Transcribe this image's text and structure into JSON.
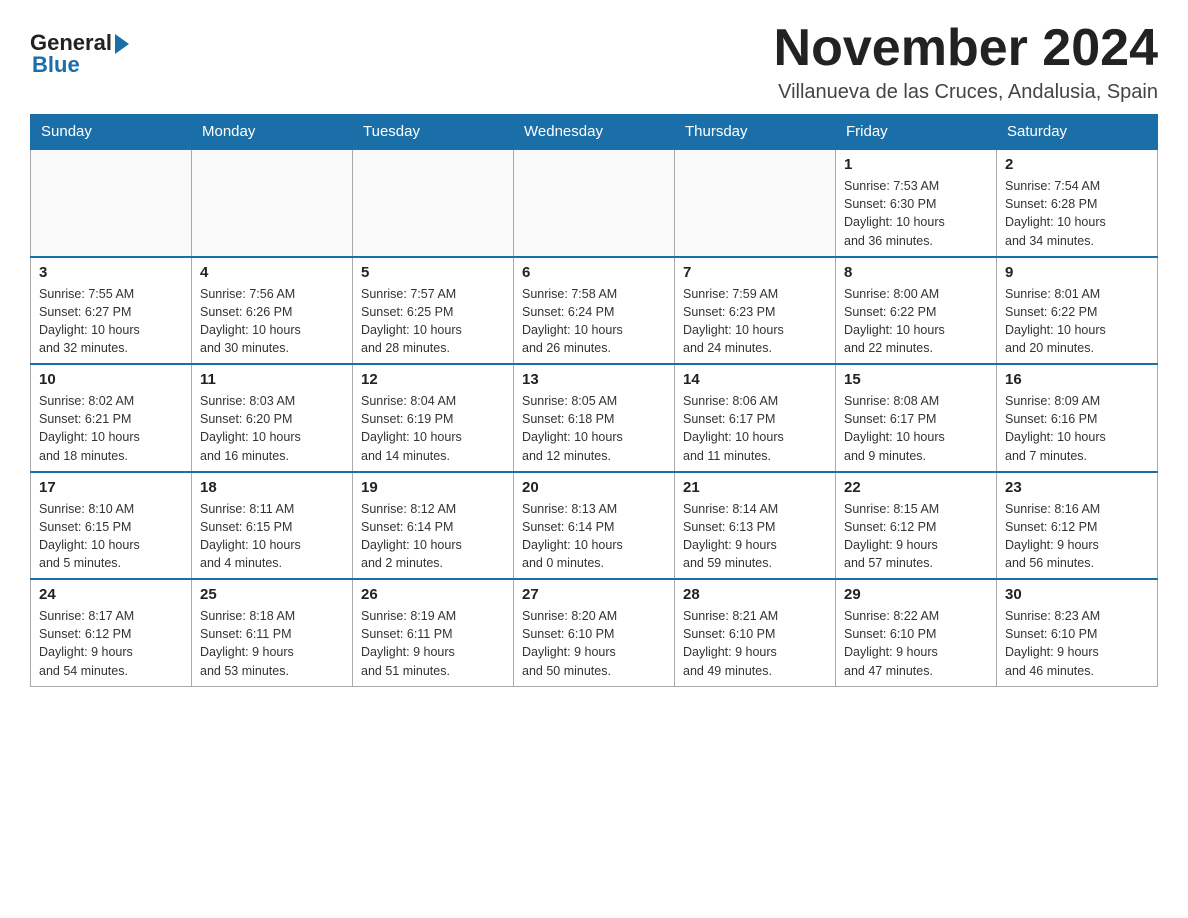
{
  "header": {
    "logo_general": "General",
    "logo_blue": "Blue",
    "month_title": "November 2024",
    "location": "Villanueva de las Cruces, Andalusia, Spain"
  },
  "days_of_week": [
    "Sunday",
    "Monday",
    "Tuesday",
    "Wednesday",
    "Thursday",
    "Friday",
    "Saturday"
  ],
  "weeks": [
    [
      {
        "day": "",
        "info": ""
      },
      {
        "day": "",
        "info": ""
      },
      {
        "day": "",
        "info": ""
      },
      {
        "day": "",
        "info": ""
      },
      {
        "day": "",
        "info": ""
      },
      {
        "day": "1",
        "info": "Sunrise: 7:53 AM\nSunset: 6:30 PM\nDaylight: 10 hours\nand 36 minutes."
      },
      {
        "day": "2",
        "info": "Sunrise: 7:54 AM\nSunset: 6:28 PM\nDaylight: 10 hours\nand 34 minutes."
      }
    ],
    [
      {
        "day": "3",
        "info": "Sunrise: 7:55 AM\nSunset: 6:27 PM\nDaylight: 10 hours\nand 32 minutes."
      },
      {
        "day": "4",
        "info": "Sunrise: 7:56 AM\nSunset: 6:26 PM\nDaylight: 10 hours\nand 30 minutes."
      },
      {
        "day": "5",
        "info": "Sunrise: 7:57 AM\nSunset: 6:25 PM\nDaylight: 10 hours\nand 28 minutes."
      },
      {
        "day": "6",
        "info": "Sunrise: 7:58 AM\nSunset: 6:24 PM\nDaylight: 10 hours\nand 26 minutes."
      },
      {
        "day": "7",
        "info": "Sunrise: 7:59 AM\nSunset: 6:23 PM\nDaylight: 10 hours\nand 24 minutes."
      },
      {
        "day": "8",
        "info": "Sunrise: 8:00 AM\nSunset: 6:22 PM\nDaylight: 10 hours\nand 22 minutes."
      },
      {
        "day": "9",
        "info": "Sunrise: 8:01 AM\nSunset: 6:22 PM\nDaylight: 10 hours\nand 20 minutes."
      }
    ],
    [
      {
        "day": "10",
        "info": "Sunrise: 8:02 AM\nSunset: 6:21 PM\nDaylight: 10 hours\nand 18 minutes."
      },
      {
        "day": "11",
        "info": "Sunrise: 8:03 AM\nSunset: 6:20 PM\nDaylight: 10 hours\nand 16 minutes."
      },
      {
        "day": "12",
        "info": "Sunrise: 8:04 AM\nSunset: 6:19 PM\nDaylight: 10 hours\nand 14 minutes."
      },
      {
        "day": "13",
        "info": "Sunrise: 8:05 AM\nSunset: 6:18 PM\nDaylight: 10 hours\nand 12 minutes."
      },
      {
        "day": "14",
        "info": "Sunrise: 8:06 AM\nSunset: 6:17 PM\nDaylight: 10 hours\nand 11 minutes."
      },
      {
        "day": "15",
        "info": "Sunrise: 8:08 AM\nSunset: 6:17 PM\nDaylight: 10 hours\nand 9 minutes."
      },
      {
        "day": "16",
        "info": "Sunrise: 8:09 AM\nSunset: 6:16 PM\nDaylight: 10 hours\nand 7 minutes."
      }
    ],
    [
      {
        "day": "17",
        "info": "Sunrise: 8:10 AM\nSunset: 6:15 PM\nDaylight: 10 hours\nand 5 minutes."
      },
      {
        "day": "18",
        "info": "Sunrise: 8:11 AM\nSunset: 6:15 PM\nDaylight: 10 hours\nand 4 minutes."
      },
      {
        "day": "19",
        "info": "Sunrise: 8:12 AM\nSunset: 6:14 PM\nDaylight: 10 hours\nand 2 minutes."
      },
      {
        "day": "20",
        "info": "Sunrise: 8:13 AM\nSunset: 6:14 PM\nDaylight: 10 hours\nand 0 minutes."
      },
      {
        "day": "21",
        "info": "Sunrise: 8:14 AM\nSunset: 6:13 PM\nDaylight: 9 hours\nand 59 minutes."
      },
      {
        "day": "22",
        "info": "Sunrise: 8:15 AM\nSunset: 6:12 PM\nDaylight: 9 hours\nand 57 minutes."
      },
      {
        "day": "23",
        "info": "Sunrise: 8:16 AM\nSunset: 6:12 PM\nDaylight: 9 hours\nand 56 minutes."
      }
    ],
    [
      {
        "day": "24",
        "info": "Sunrise: 8:17 AM\nSunset: 6:12 PM\nDaylight: 9 hours\nand 54 minutes."
      },
      {
        "day": "25",
        "info": "Sunrise: 8:18 AM\nSunset: 6:11 PM\nDaylight: 9 hours\nand 53 minutes."
      },
      {
        "day": "26",
        "info": "Sunrise: 8:19 AM\nSunset: 6:11 PM\nDaylight: 9 hours\nand 51 minutes."
      },
      {
        "day": "27",
        "info": "Sunrise: 8:20 AM\nSunset: 6:10 PM\nDaylight: 9 hours\nand 50 minutes."
      },
      {
        "day": "28",
        "info": "Sunrise: 8:21 AM\nSunset: 6:10 PM\nDaylight: 9 hours\nand 49 minutes."
      },
      {
        "day": "29",
        "info": "Sunrise: 8:22 AM\nSunset: 6:10 PM\nDaylight: 9 hours\nand 47 minutes."
      },
      {
        "day": "30",
        "info": "Sunrise: 8:23 AM\nSunset: 6:10 PM\nDaylight: 9 hours\nand 46 minutes."
      }
    ]
  ]
}
